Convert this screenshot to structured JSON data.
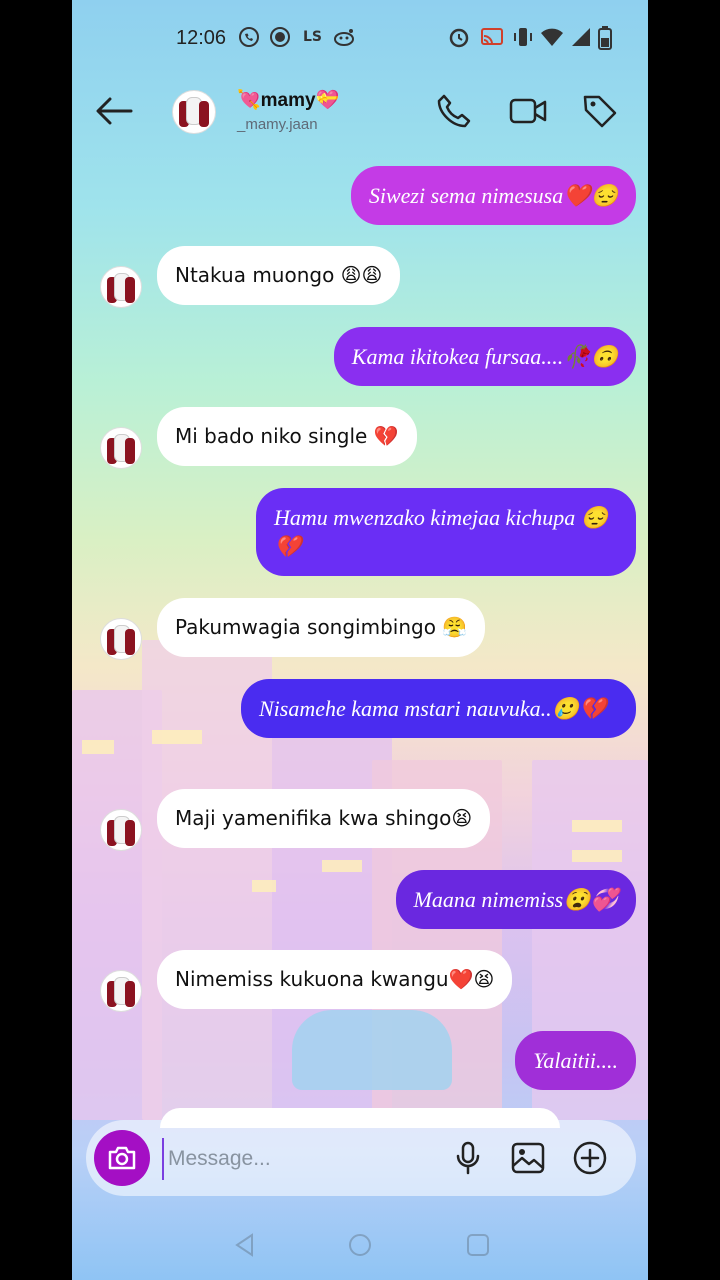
{
  "status": {
    "time": "12:06",
    "left_icons": [
      "whatsapp-icon",
      "record-icon",
      "ls-icon",
      "reddit-icon"
    ],
    "right_icons": [
      "alarm-icon",
      "cast-icon",
      "vibrate-icon",
      "wifi-icon",
      "signal-icon",
      "battery-icon"
    ],
    "ls_text": "LS"
  },
  "header": {
    "contact_name": "💘mamy💝",
    "username": "_mamy.jaan"
  },
  "messages": [
    {
      "dir": "out",
      "text": "Siwezi sema nimesusa❤️😔"
    },
    {
      "dir": "in",
      "text": "Ntakua muongo 😩😩"
    },
    {
      "dir": "out",
      "text": "Kama ikitokea fursaa....🥀🙃"
    },
    {
      "dir": "in",
      "text": "Mi bado niko single 💔"
    },
    {
      "dir": "out",
      "text": "Hamu mwenzako kimejaa kichupa 😔💔"
    },
    {
      "dir": "in",
      "text": "Pakumwagia songimbingo 😤"
    },
    {
      "dir": "out",
      "text": "Nisamehe kama mstari nauvuka..🥲💔"
    },
    {
      "dir": "in",
      "text": "Maji yamenifika kwa shingo😫"
    },
    {
      "dir": "out",
      "text": "Maana nimemiss😧💞"
    },
    {
      "dir": "in",
      "text": "Nimemiss kukuona kwangu❤️😫"
    },
    {
      "dir": "out",
      "text": "Yalaitii...."
    }
  ],
  "composer": {
    "placeholder": "Message..."
  },
  "colors": {
    "bubble_pink": "#c43be6",
    "bubble_purple1": "#8a2ff0",
    "bubble_purple2": "#6a2ef5",
    "bubble_blue": "#4a2cf0",
    "camera": "#a40fc4"
  }
}
